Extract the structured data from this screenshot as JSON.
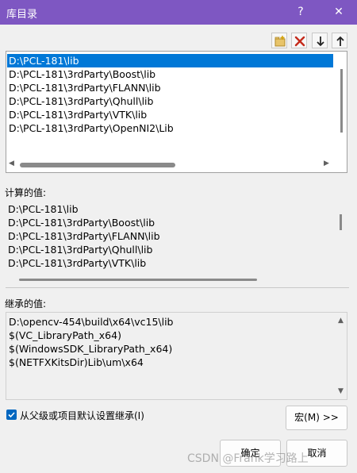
{
  "window": {
    "title": "库目录",
    "help_glyph": "?",
    "close_glyph": "✕"
  },
  "editable_list": {
    "items": [
      "D:\\PCL-181\\lib",
      "D:\\PCL-181\\3rdParty\\Boost\\lib",
      "D:\\PCL-181\\3rdParty\\FLANN\\lib",
      "D:\\PCL-181\\3rdParty\\Qhull\\lib",
      "D:\\PCL-181\\3rdParty\\VTK\\lib",
      "D:\\PCL-181\\3rdParty\\OpenNI2\\Lib"
    ],
    "selected_index": 0
  },
  "computed": {
    "label": "计算的值:",
    "items": [
      "D:\\PCL-181\\lib",
      "D:\\PCL-181\\3rdParty\\Boost\\lib",
      "D:\\PCL-181\\3rdParty\\FLANN\\lib",
      "D:\\PCL-181\\3rdParty\\Qhull\\lib",
      "D:\\PCL-181\\3rdParty\\VTK\\lib"
    ]
  },
  "inherited": {
    "label": "继承的值:",
    "items": [
      "D:\\opencv-454\\build\\x64\\vc15\\lib",
      "$(VC_LibraryPath_x64)",
      "$(WindowsSDK_LibraryPath_x64)",
      "$(NETFXKitsDir)Lib\\um\\x64"
    ]
  },
  "inherit_checkbox": {
    "label": "从父级或项目默认设置继承(I)",
    "checked": true
  },
  "buttons": {
    "macro": "宏(M) >>",
    "ok": "确定",
    "cancel": "取消"
  },
  "watermark": "CSDN @Frank学习路上",
  "icons": {
    "toolbar": [
      "new-line-icon",
      "delete-icon",
      "move-down-icon",
      "move-up-icon"
    ]
  },
  "colors": {
    "title_bar": "#7e57c2",
    "selection": "#0078d7",
    "delete_red": "#c42b1c"
  }
}
